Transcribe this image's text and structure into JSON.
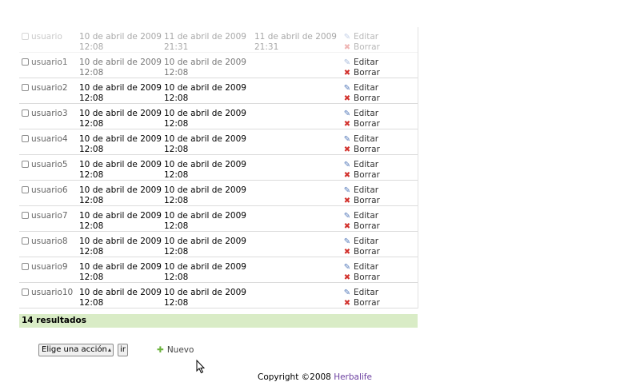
{
  "table": {
    "rows": [
      {
        "user": "usuario",
        "created_date": "10 de abril de 2009",
        "created_time": "12:08",
        "updated_date": "11 de abril de 2009",
        "updated_time": "21:31",
        "extra_date": "11 de abril de 2009",
        "extra_time": "21:31",
        "edit_label": "Editar",
        "delete_label": "Borrar"
      },
      {
        "user": "usuario1",
        "created_date": "10 de abril de 2009",
        "created_time": "12:08",
        "updated_date": "10 de abril de 2009",
        "updated_time": "12:08",
        "edit_label": "Editar",
        "delete_label": "Borrar"
      },
      {
        "user": "usuario2",
        "created_date": "10 de abril de 2009",
        "created_time": "12:08",
        "updated_date": "10 de abril de 2009",
        "updated_time": "12:08",
        "edit_label": "Editar",
        "delete_label": "Borrar"
      },
      {
        "user": "usuario3",
        "created_date": "10 de abril de 2009",
        "created_time": "12:08",
        "updated_date": "10 de abril de 2009",
        "updated_time": "12:08",
        "edit_label": "Editar",
        "delete_label": "Borrar"
      },
      {
        "user": "usuario4",
        "created_date": "10 de abril de 2009",
        "created_time": "12:08",
        "updated_date": "10 de abril de 2009",
        "updated_time": "12:08",
        "edit_label": "Editar",
        "delete_label": "Borrar"
      },
      {
        "user": "usuario5",
        "created_date": "10 de abril de 2009",
        "created_time": "12:08",
        "updated_date": "10 de abril de 2009",
        "updated_time": "12:08",
        "edit_label": "Editar",
        "delete_label": "Borrar"
      },
      {
        "user": "usuario6",
        "created_date": "10 de abril de 2009",
        "created_time": "12:08",
        "updated_date": "10 de abril de 2009",
        "updated_time": "12:08",
        "edit_label": "Editar",
        "delete_label": "Borrar"
      },
      {
        "user": "usuario7",
        "created_date": "10 de abril de 2009",
        "created_time": "12:08",
        "updated_date": "10 de abril de 2009",
        "updated_time": "12:08",
        "edit_label": "Editar",
        "delete_label": "Borrar"
      },
      {
        "user": "usuario8",
        "created_date": "10 de abril de 2009",
        "created_time": "12:08",
        "updated_date": "10 de abril de 2009",
        "updated_time": "12:08",
        "edit_label": "Editar",
        "delete_label": "Borrar"
      },
      {
        "user": "usuario9",
        "created_date": "10 de abril de 2009",
        "created_time": "12:08",
        "updated_date": "10 de abril de 2009",
        "updated_time": "12:08",
        "edit_label": "Editar",
        "delete_label": "Borrar"
      },
      {
        "user": "usuario10",
        "created_date": "10 de abril de 2009",
        "created_time": "12:08",
        "updated_date": "10 de abril de 2009",
        "updated_time": "12:08",
        "edit_label": "Editar",
        "delete_label": "Borrar"
      }
    ],
    "results_label": "14 resultados"
  },
  "batch_actions": {
    "select_value": "Elige una acción",
    "go_label": "ir"
  },
  "new_label": "Nuevo",
  "footer": {
    "copyright_text": "Copyright ©2008 ",
    "brand": "Herbalife"
  },
  "colors": {
    "results_bar": "#d9ecc6",
    "brand_link": "#6b3fa0",
    "edit_icon": "#5177b8",
    "delete_icon": "#d2322d",
    "new_icon": "#6db33f"
  }
}
